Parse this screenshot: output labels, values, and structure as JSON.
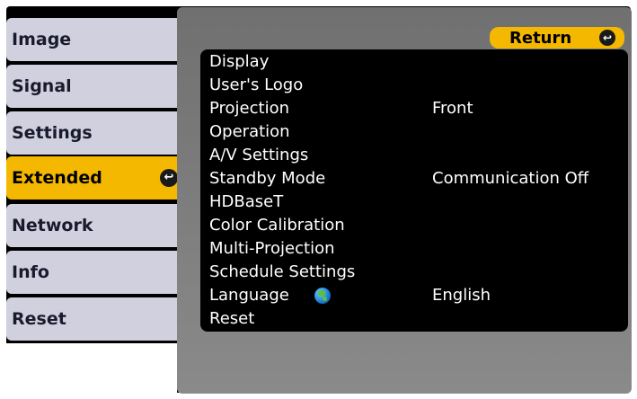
{
  "sidebar": {
    "items": [
      {
        "label": "Image"
      },
      {
        "label": "Signal"
      },
      {
        "label": "Settings"
      },
      {
        "label": "Extended",
        "active": true
      },
      {
        "label": "Network"
      },
      {
        "label": "Info"
      },
      {
        "label": "Reset"
      }
    ],
    "active_icon": "enter-icon",
    "active_icon_glyph": "↩"
  },
  "panel": {
    "return_label": "Return",
    "return_icon": "enter-icon",
    "return_icon_glyph": "↩",
    "items": [
      {
        "label": "Display",
        "value": ""
      },
      {
        "label": "User's Logo",
        "value": ""
      },
      {
        "label": "Projection",
        "value": "Front"
      },
      {
        "label": "Operation",
        "value": ""
      },
      {
        "label": "A/V Settings",
        "value": ""
      },
      {
        "label": "Standby Mode",
        "value": "Communication Off"
      },
      {
        "label": "HDBaseT",
        "value": ""
      },
      {
        "label": "Color Calibration",
        "value": ""
      },
      {
        "label": "Multi-Projection",
        "value": ""
      },
      {
        "label": "Schedule Settings",
        "value": ""
      },
      {
        "label": "Language",
        "value": "English",
        "icon": "globe-icon"
      },
      {
        "label": "Reset",
        "value": ""
      }
    ]
  },
  "colors": {
    "accent": "#f5b800",
    "tab_bg": "#d0d0de",
    "panel_bg": "#000000"
  }
}
